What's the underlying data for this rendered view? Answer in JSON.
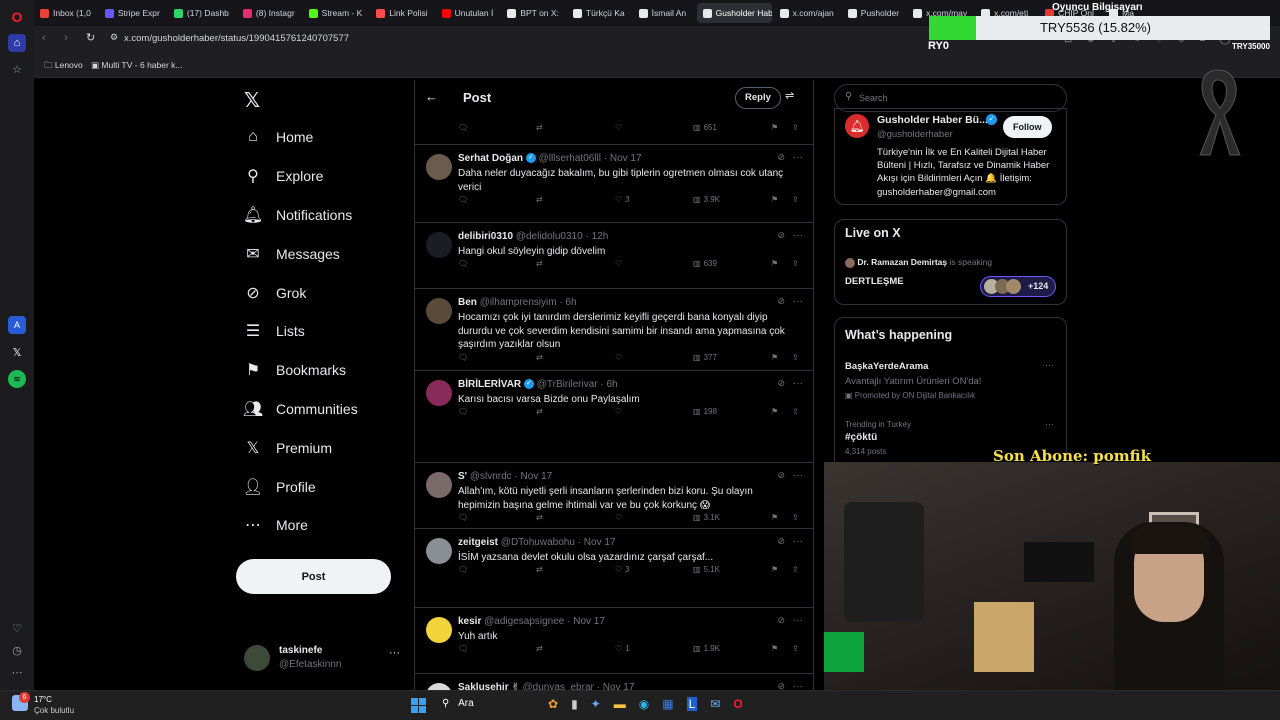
{
  "browser": {
    "tabs": [
      {
        "label": "Inbox (1,0",
        "color": "#ea4335"
      },
      {
        "label": "Stripe Expr",
        "color": "#635bff"
      },
      {
        "label": "(17) Dashb",
        "color": "#2bd66b"
      },
      {
        "label": "(8) Instagr",
        "color": "#e1306c"
      },
      {
        "label": "Stream - K",
        "color": "#53fc18"
      },
      {
        "label": "Link Polisi",
        "color": "#ff4d4d"
      },
      {
        "label": "Unutulan İ",
        "color": "#ff0000"
      },
      {
        "label": "BPT on X:",
        "color": "#e7e9ea"
      },
      {
        "label": "Türkçü Ka",
        "color": "#e7e9ea"
      },
      {
        "label": "İsmail An",
        "color": "#e7e9ea"
      },
      {
        "label": "Gusholder Haber B",
        "color": "#e7e9ea"
      },
      {
        "label": "x.com/ajan",
        "color": "#e7e9ea"
      },
      {
        "label": "Pusholder",
        "color": "#e7e9ea"
      },
      {
        "label": "x.com/may",
        "color": "#e7e9ea"
      },
      {
        "label": "x.com/eti",
        "color": "#e7e9ea"
      },
      {
        "label": "CHIP Onl",
        "color": "#e53935"
      },
      {
        "label": "Ma",
        "color": "#e7e9ea"
      }
    ],
    "url": "x.com/gusholderhaber/status/1990415761240707577",
    "bookmarks": [
      "Lenovo",
      "Multi TV - 6 haber k..."
    ]
  },
  "stream_overlay": {
    "pc_label": "Oyuncu Bilgisayarı",
    "goal_text": "TRY5536 (15.82%)",
    "goal_progress": 0.1582,
    "goal_start": "RY0",
    "goal_end": "TRY35000",
    "last_sub": "Son Abone: pomfik"
  },
  "nav": {
    "items": [
      {
        "label": "Home",
        "icon": "home-icon",
        "glyph": "⌂"
      },
      {
        "label": "Explore",
        "icon": "search-icon",
        "glyph": "⚲"
      },
      {
        "label": "Notifications",
        "icon": "bell-icon",
        "glyph": "🔔︎"
      },
      {
        "label": "Messages",
        "icon": "mail-icon",
        "glyph": "✉"
      },
      {
        "label": "Grok",
        "icon": "grok-icon",
        "glyph": "⊘"
      },
      {
        "label": "Lists",
        "icon": "list-icon",
        "glyph": "☰"
      },
      {
        "label": "Bookmarks",
        "icon": "bookmark-icon",
        "glyph": "⚑"
      },
      {
        "label": "Communities",
        "icon": "communities-icon",
        "glyph": "👥︎"
      },
      {
        "label": "Premium",
        "icon": "x-logo-icon",
        "glyph": "𝕏"
      },
      {
        "label": "Profile",
        "icon": "profile-icon",
        "glyph": "👤︎"
      },
      {
        "label": "More",
        "icon": "more-circle-icon",
        "glyph": "⋯"
      }
    ],
    "post_label": "Post",
    "account": {
      "name": "taskinefe",
      "handle": "@Efetaskinnn"
    }
  },
  "feed": {
    "title": "Post",
    "reply_label": "Reply",
    "top_views": "651",
    "tweets": [
      {
        "name": "Serhat Doğan",
        "verified": true,
        "handle": "@lllserhat06lll",
        "time": "· Nov 17",
        "text": "Daha neler duyacağız bakalım, bu gibi tiplerin ogretmen olması cok utanç verici",
        "likes": "3",
        "views": "3.9K",
        "avatar": "#6b5b4f"
      },
      {
        "name": "delibiri0310",
        "verified": false,
        "handle": "@delidolu0310",
        "time": "· 12h",
        "text": "Hangi okul söyleyin gidip dövelim",
        "likes": "",
        "views": "639",
        "avatar": "#1a1d24"
      },
      {
        "name": "Ben",
        "verified": false,
        "handle": "@ilhamprensiyim",
        "time": "· 6h",
        "text": "Hocamızı çok iyi tanırdım derslerimiz keyifli geçerdi bana konyalı diyip dururdu ve çok severdim kendisini samimi bir insandı ama yapmasına çok şaşırdım yazıklar olsun",
        "likes": "",
        "views": "377",
        "avatar": "#5a4a3a"
      },
      {
        "name": "BİRİLERİVAR",
        "verified": true,
        "handle": "@TrBirilerivar",
        "time": "· 6h",
        "text": "Karısı bacısı varsa Bizde onu Paylaşalım",
        "likes": "",
        "views": "198",
        "avatar": "#8a2a5a"
      },
      {
        "name": "S'",
        "verified": false,
        "handle": "@slvnrdc",
        "time": "· Nov 17",
        "text": "Allah'ım, kötü niyetli şerli insanların şerlerinden bizi koru. Şu olayın hepimizin başına gelme ihtimali var ve bu çok korkunç 😱",
        "likes": "",
        "views": "3.1K",
        "avatar": "#7a6a6a"
      },
      {
        "name": "zeitgeist",
        "verified": false,
        "handle": "@DTohuwabohu",
        "time": "· Nov 17",
        "text": "İSİM yazsana devlet okulu olsa yazardınız çarşaf çarşaf...",
        "likes": "3",
        "views": "5.1K",
        "avatar": "#8a8f96"
      },
      {
        "name": "kesir",
        "verified": false,
        "handle": "@adigesapsignee",
        "time": "· Nov 17",
        "text": "Yuh artık",
        "likes": "1",
        "views": "1.9K",
        "avatar": "#f2d33a"
      },
      {
        "name": "Sakluşehir ✌",
        "verified": false,
        "handle": "@dunyas_ebrar",
        "time": "· Nov 17",
        "text": "",
        "likes": "",
        "views": "",
        "avatar": "#d9d9d9"
      }
    ]
  },
  "right": {
    "search_placeholder": "Search",
    "profile_card": {
      "name": "Gusholder Haber Bü...",
      "handle": "@gusholderhaber",
      "follow_label": "Follow",
      "bio": "Türkiye'nin İlk ve En Kaliteli Dijital Haber Bülteni | Hızlı, Tarafsız ve Dinamik Haber Akışı için Bildirimleri Açın 🔔 İletişim: gusholderhaber@gmail.com"
    },
    "live": {
      "title": "Live on X",
      "host": "Dr. Ramazan Demirtaş",
      "speaking": "is speaking",
      "space": "DERTLEŞME",
      "listeners": "+124"
    },
    "happening": {
      "title": "What’s happening",
      "promo": {
        "name": "BaşkaYerdeArama",
        "text": "Avantajlı Yatırım Ürünleri ON'da!",
        "promoted": "Promoted by ON Dijital Bankacılık"
      },
      "trend": {
        "context": "Trending in Turkey",
        "tag": "#çöktü",
        "posts": "4,314 posts"
      }
    }
  },
  "taskbar": {
    "temp": "17°C",
    "weather": "Çok bulutlu",
    "search": "Ara",
    "weather_badge": "6"
  }
}
